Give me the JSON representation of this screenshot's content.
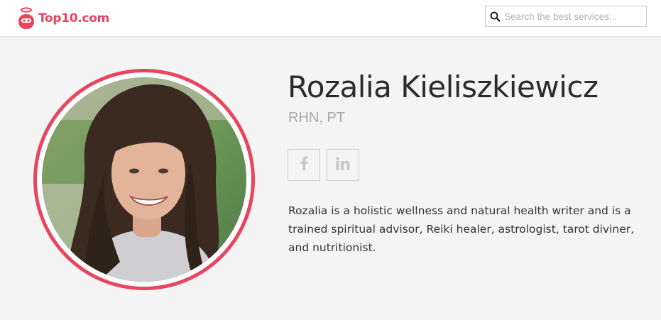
{
  "header": {
    "logo_text": "Top10.com",
    "search_placeholder": "Search the best services..."
  },
  "profile": {
    "name": "Rozalia Kieliszkiewicz",
    "credentials": "RHN, PT",
    "photo_icon": "profile-photo",
    "social": [
      {
        "network": "facebook",
        "icon": "facebook-icon"
      },
      {
        "network": "linkedin",
        "icon": "linkedin-icon"
      }
    ],
    "bio": "Rozalia is a holistic wellness and natural health writer and is a trained spiritual advisor, Reiki healer, astrologist, tarot diviner, and nutritionist."
  },
  "colors": {
    "brand": "#e8455f",
    "background": "#f4f4f4",
    "text": "#2b2b2b",
    "muted": "#a8a8a8"
  }
}
